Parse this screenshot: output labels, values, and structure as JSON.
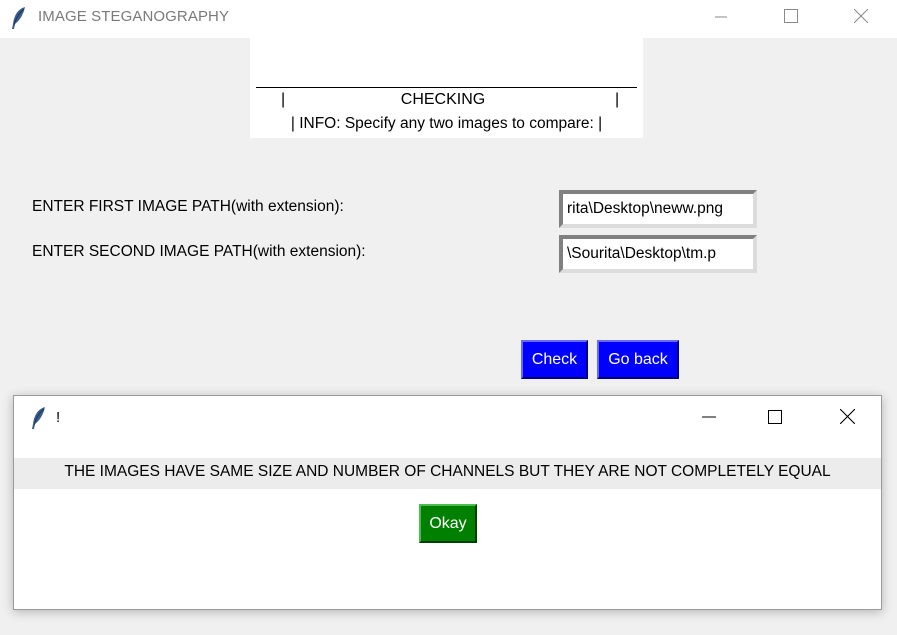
{
  "window": {
    "title": "IMAGE STEGANOGRAPHY",
    "app_icon": "feather-icon",
    "controls": [
      "minimize-icon",
      "maximize-icon",
      "close-icon"
    ]
  },
  "header": {
    "title": "CHECKING",
    "left_pipe": "|",
    "right_pipe": "|",
    "info": "| INFO: Specify any two images to compare: |"
  },
  "form": {
    "first_label": "ENTER FIRST IMAGE PATH(with extension):",
    "first_value": "rita\\Desktop\\neww.png",
    "second_label": "ENTER SECOND IMAGE PATH(with extension):",
    "second_value": "\\Sourita\\Desktop\\tm.p",
    "check_label": "Check",
    "back_label": "Go back"
  },
  "dialog": {
    "title": "!",
    "message": "THE IMAGES HAVE SAME SIZE AND NUMBER OF CHANNELS BUT THEY ARE NOT COMPLETELY EQUAL",
    "okay_label": "Okay"
  },
  "colors": {
    "window_bg": "#f0f0f0",
    "check_button_bg": "#0000ff",
    "back_button_bg": "#0000ff",
    "okay_button_bg": "#008000",
    "button_text": "#ffffff"
  }
}
